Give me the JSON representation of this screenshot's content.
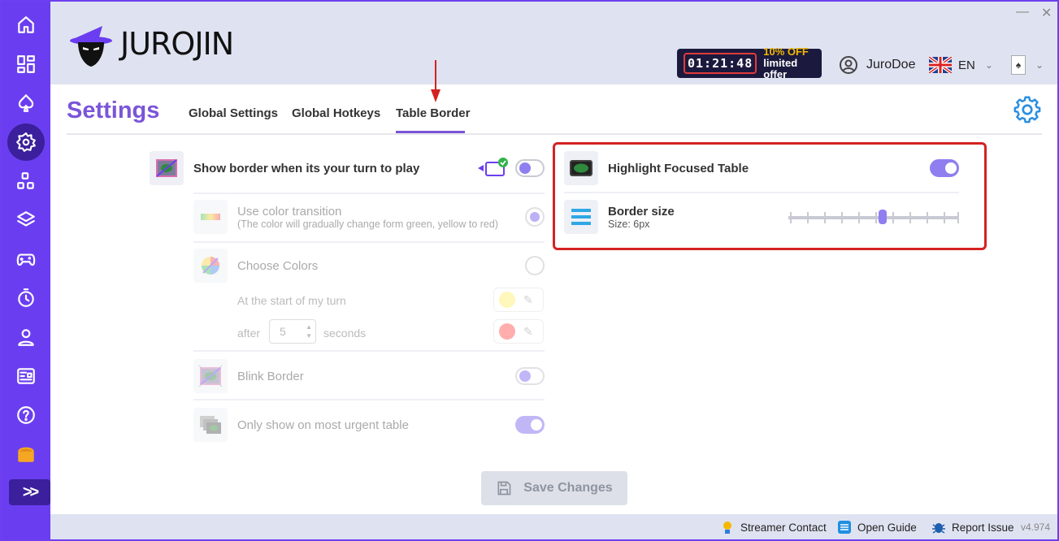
{
  "app": {
    "logo_text": "JUROJIN",
    "window_controls": {
      "minimize": "—",
      "close": "✕"
    }
  },
  "header": {
    "timer": "01:21:48",
    "promo_line1": "10% OFF",
    "promo_line2": "limited offer",
    "username": "JuroDoe",
    "language": "EN"
  },
  "sidebar": {
    "items": [
      {
        "icon": "home-icon"
      },
      {
        "icon": "dashboard-icon"
      },
      {
        "icon": "spade-icon"
      },
      {
        "icon": "settings-icon",
        "active": true
      },
      {
        "icon": "apps-icon"
      },
      {
        "icon": "layers-icon"
      },
      {
        "icon": "gamepad-icon"
      },
      {
        "icon": "timer-icon"
      },
      {
        "icon": "user-icon"
      },
      {
        "icon": "news-icon"
      },
      {
        "icon": "help-icon"
      },
      {
        "icon": "chest-icon"
      }
    ],
    "expand_label": ">>"
  },
  "settings": {
    "title": "Settings",
    "tabs": [
      "Global Settings",
      "Global Hotkeys",
      "Table Border"
    ],
    "active_tab": "Table Border",
    "left": {
      "show_border_label": "Show border when its your turn to play",
      "show_border_on": false,
      "color_transition_label": "Use color transition",
      "color_transition_sub": "(The color will gradually change form green, yellow to red)",
      "choose_colors_label": "Choose Colors",
      "start_turn_label": "At the start of my turn",
      "after_label": "after",
      "after_value": "5",
      "seconds_label": "seconds",
      "blink_label": "Blink Border",
      "blink_on": false,
      "urgent_label": "Only show on most urgent table",
      "urgent_on": true
    },
    "right": {
      "highlight_label": "Highlight Focused Table",
      "highlight_on": true,
      "border_size_label": "Border size",
      "border_size_sub": "Size: 6px",
      "border_size_value": 6,
      "border_size_max": 10
    },
    "save_label": "Save Changes"
  },
  "statusbar": {
    "streamer": "Streamer Contact",
    "guide": "Open Guide",
    "report": "Report Issue",
    "version": "v4.974"
  },
  "colors": {
    "accent": "#7a55d8",
    "sidebar": "#6a3ef0",
    "toggle": "#8f7ef0",
    "highlight_border": "#d42222",
    "start_color": "#ffef6b",
    "end_color": "#ff4b4b"
  }
}
